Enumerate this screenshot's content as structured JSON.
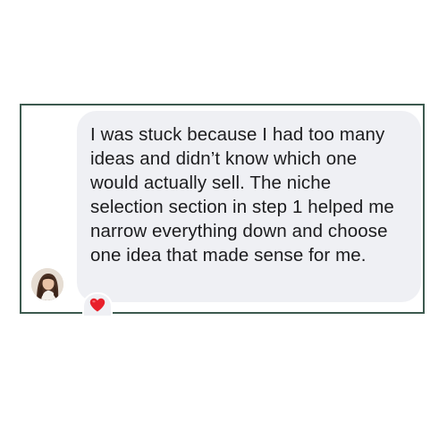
{
  "message": {
    "text": "I was stuck because I had too many ideas and didn’t know which one would actually sell. The niche selection section in step 1 helped me narrow everything down and choose one idea that made sense for me.",
    "bubble_color": "#eff0f4",
    "text_color": "#1c1c1e"
  },
  "sender": {
    "avatar_icon": "profile-photo"
  },
  "reaction": {
    "icon": "heart-icon",
    "color": "#e8202a"
  },
  "frame": {
    "border_color": "#3d5a4f"
  }
}
